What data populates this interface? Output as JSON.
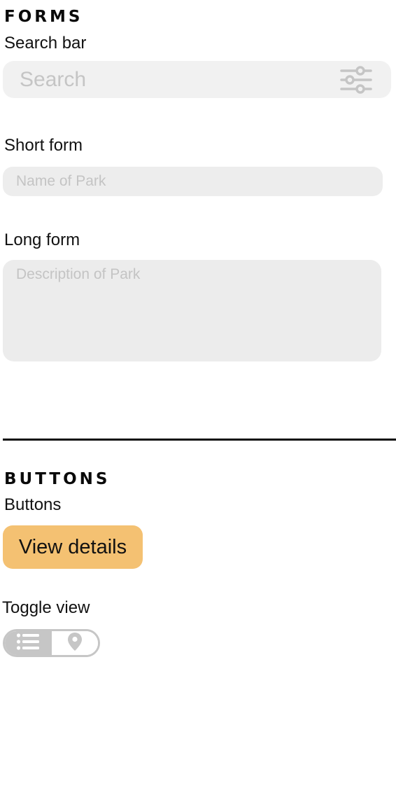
{
  "forms": {
    "title": "FORMS",
    "search_bar_label": "Search bar",
    "search_placeholder": "Search",
    "short_form_label": "Short form",
    "short_form_placeholder": "Name of Park",
    "long_form_label": "Long form",
    "long_form_placeholder": "Description of Park"
  },
  "buttons": {
    "title": "BUTTONS",
    "buttons_label": "Buttons",
    "view_details_label": "View details",
    "toggle_label": "Toggle view",
    "toggle_options": [
      {
        "icon": "list-icon",
        "active": true
      },
      {
        "icon": "map-pin-icon",
        "active": false
      }
    ]
  },
  "colors": {
    "accent": "#f4c172",
    "field_bg": "#ededed",
    "toggle_gray": "#c6c6c6"
  }
}
